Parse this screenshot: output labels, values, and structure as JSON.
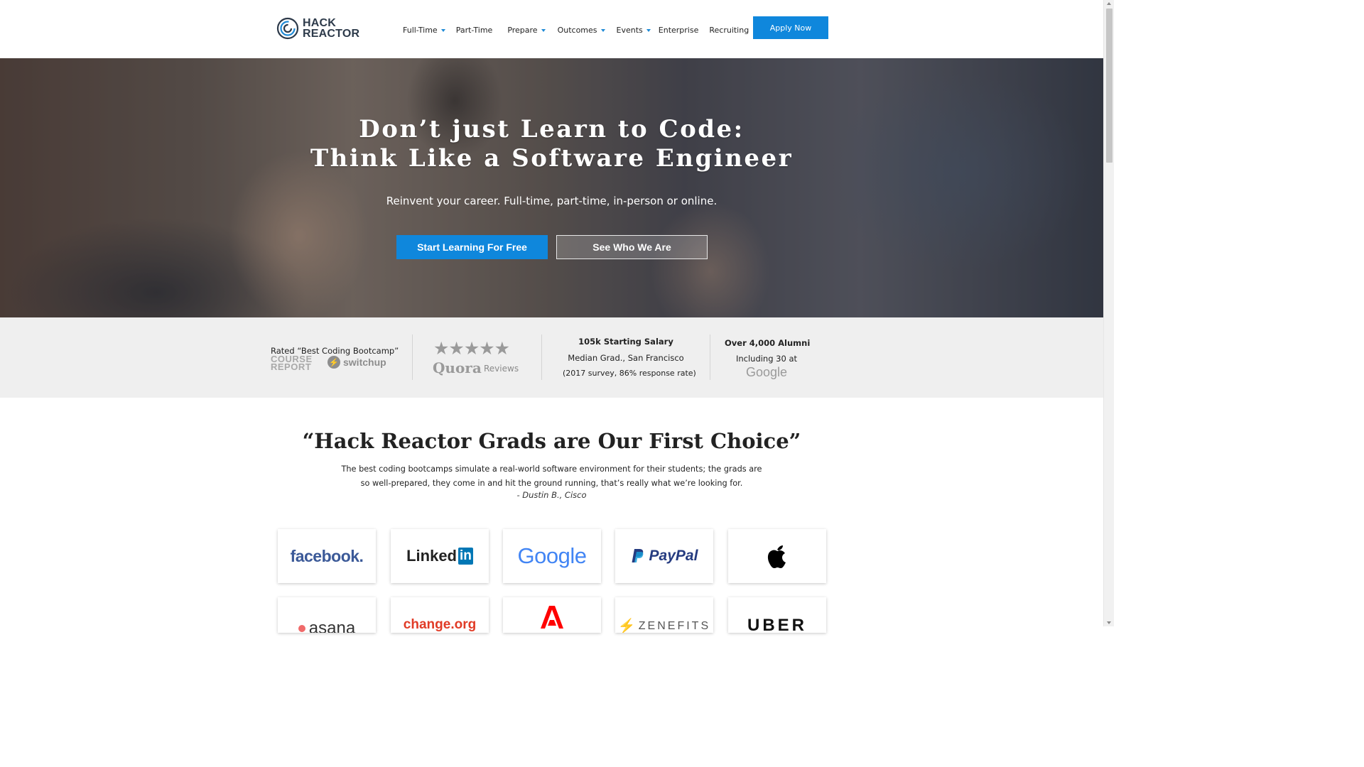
{
  "header": {
    "logo_line1": "HACK",
    "logo_line2": "REACTOR",
    "nav": [
      {
        "label": "Full-Time",
        "dropdown": true
      },
      {
        "label": "Part-Time",
        "dropdown": false
      },
      {
        "label": "Prepare",
        "dropdown": true
      },
      {
        "label": "Outcomes",
        "dropdown": true
      },
      {
        "label": "Events",
        "dropdown": true
      },
      {
        "label": "Enterprise",
        "dropdown": false
      },
      {
        "label": "Recruiting",
        "dropdown": false
      }
    ],
    "apply_label": "Apply Now"
  },
  "hero": {
    "title_line1": "Don’t just Learn to Code:",
    "title_line2": "Think Like a Software Engineer",
    "subtitle": "Reinvent your career. Full-time, part-time, in-person or online.",
    "primary_cta": "Start Learning For Free",
    "secondary_cta": "See Who We Are"
  },
  "stats": {
    "rated_text": "Rated “Best Coding Bootcamp”",
    "course_report_line1": "COURSE",
    "course_report_line2": "REPORT",
    "switchup_text": "switchup",
    "stars": "★★★★★",
    "quora_text": "Quora",
    "quora_reviews": "Reviews",
    "salary_title": "105k Starting Salary",
    "salary_sub1": "Median Grad., San Francisco",
    "salary_sub2": "(2017 survey, 86% response rate)",
    "alumni_title": "Over 4,000 Alumni",
    "alumni_sub": "Including 30 at",
    "alumni_company": "Google"
  },
  "quote": {
    "title": "“Hack Reactor Grads are Our First Choice”",
    "body": "The best coding bootcamps simulate a real-world software environment for their students; the grads are so well-prepared, they come in and hit the ground running, that’s really what we’re looking for.",
    "author": "- Dustin B., Cisco"
  },
  "companies": {
    "row1": [
      "facebook.",
      "Linked",
      "in",
      "Google",
      "PayPal",
      "apple"
    ],
    "row2": [
      "asana",
      "change.org",
      "adobe",
      "ZENEFITS",
      "UBER"
    ]
  },
  "colors": {
    "accent": "#0f87dc",
    "facebook": "#3b5998",
    "linkedin": "#0077b5",
    "paypal_dark": "#253b80",
    "paypal_light": "#179bd7",
    "asana": "#f06a6a",
    "change": "#e13b26",
    "adobe": "#ff0000",
    "zenefits": "#f5a623"
  }
}
